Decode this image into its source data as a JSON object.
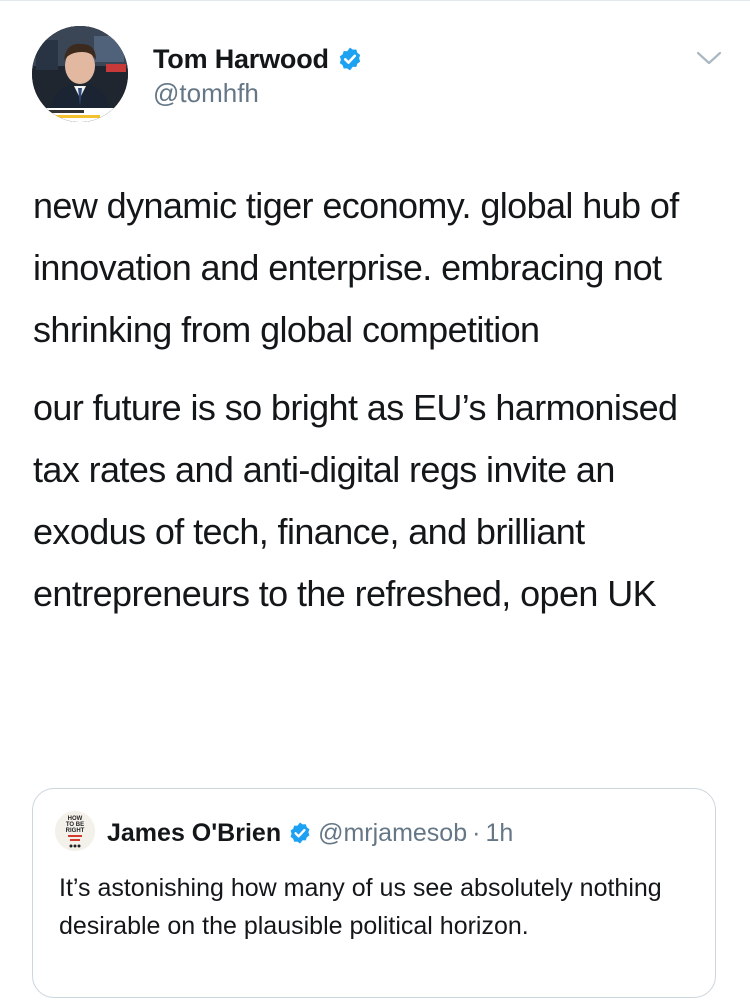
{
  "tweet": {
    "author": {
      "name": "Tom Harwood",
      "handle": "@tomhfh",
      "verified": true,
      "avatar_icon": "profile-photo-news-presenter"
    },
    "menu_icon": "chevron-down-icon",
    "paragraphs": [
      "new dynamic tiger economy. global hub of innovation and enterprise. embracing not shrinking from global competition",
      "our future is so bright as EU’s harmonised tax rates and anti-digital regs invite an exodus of tech, finance, and brilliant entrepreneurs to the refreshed, open UK"
    ]
  },
  "quoted_tweet": {
    "author": {
      "name": "James O'Brien",
      "handle": "@mrjamesob",
      "verified": true,
      "avatar_text": "HOW TO BE RIGHT"
    },
    "separator": "·",
    "time": "1h",
    "text": "It’s astonishing how many of us see absolutely nothing desirable on the plausible political horizon."
  },
  "colors": {
    "verified_blue": "#1da1f2",
    "secondary_text": "#657786",
    "border": "#ccd6dd"
  }
}
